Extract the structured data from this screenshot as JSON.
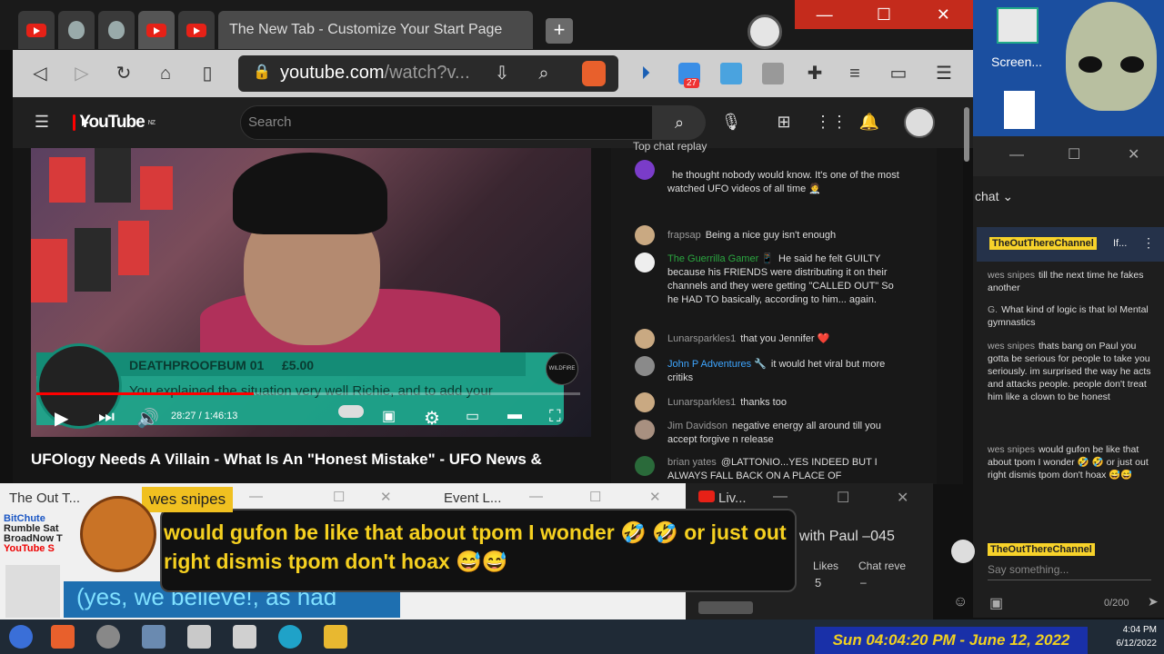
{
  "browser": {
    "active_tab_title": "The New Tab - Customize Your Start Page",
    "new_tab_label": "+",
    "url_main": "youtube.com",
    "url_rest": "/watch?v...",
    "window_controls": [
      "—",
      "☐",
      "✕"
    ],
    "extension_badge": "27"
  },
  "youtube": {
    "logo_text": "YouTube",
    "logo_sup": "NZ",
    "search_placeholder": "Search"
  },
  "video": {
    "superchat_name": "DEATHPROOFBUM 01",
    "superchat_amount": "£5.00",
    "superchat_message": "You explained the situation very well Richie, and to add your",
    "time": "28:27 / 1:46:13",
    "watermark": "WILDFIRE",
    "title": "UFOlogy Needs A Villain - What Is An \"Honest Mistake\" - UFO News &"
  },
  "live_chat": {
    "header": "Top chat replay",
    "messages": [
      {
        "author": "",
        "text": "he thought nobody would know. It's one of the most watched UFO videos of all time 🧑‍⚕️",
        "style": ""
      },
      {
        "author": "frapsap",
        "text": "Being a nice guy isn't enough",
        "style": ""
      },
      {
        "author": "The Guerrilla Gamer 📱",
        "text": "He said he felt GUILTY because his FRIENDS were distributing it on their channels and they were getting \"CALLED OUT\" So he HAD TO basically, according to him... again.",
        "style": "g"
      },
      {
        "author": "Lunarsparkles1",
        "text": "that you Jennifer ❤️",
        "style": ""
      },
      {
        "author": "John P Adventures 🔧",
        "text": "it would het viral but more critiks",
        "style": "b"
      },
      {
        "author": "Lunarsparkles1",
        "text": "thanks too",
        "style": ""
      },
      {
        "author": "Jim Davidson",
        "text": "negative energy all around till you accept forgive n release",
        "style": ""
      },
      {
        "author": "brian yates",
        "text": "@LATTONIO...YES INDEED BUT I ALWAYS FALL BACK ON A PLACE OF",
        "style": ""
      }
    ]
  },
  "popout_chat": {
    "title": "chat ⌄",
    "pinned_badge": "TheOutThereChannel",
    "pinned_text": "If...",
    "messages": [
      {
        "author": "wes snipes",
        "text": "till the next time he fakes another"
      },
      {
        "author": "G.",
        "text": "What kind of logic is that lol Mental gymnastics"
      },
      {
        "author": "wes snipes",
        "text": "thats bang on Paul you gotta be serious for people to take you seriously. im surprised the way he acts and attacks people. people don't treat him like a clown to be honest"
      },
      {
        "author": "wes snipes",
        "text": "would gufon be like that about tpom I wonder 🤣 🤣 or just out right dismis tpom don't hoax 😅😅"
      }
    ],
    "input_badge": "TheOutThereChannel",
    "input_placeholder": "Say something...",
    "char_count": "0/200"
  },
  "overlay": {
    "win1_title": "The Out T...",
    "win2_title": "Event L...",
    "win3_title": "Liv...",
    "big_author": "wes snipes",
    "big_message": "would gufon be like that about tpom I wonder 🤣 🤣 or just out right dismis tpom don't hoax 😅😅",
    "believe_text": "(yes, we believe!, as had",
    "stream_title": "t with Paul –045",
    "likes_label": "Likes",
    "likes_value": "5",
    "chat_rev_label": "Chat reve",
    "chat_rev_value": "–",
    "bitchute_lines": [
      "BitChute",
      "Rumble Sat",
      "BroadNow T",
      "YouTube S"
    ]
  },
  "desktop": {
    "screen_label": "Screen..."
  },
  "taskbar": {
    "date_banner": "Sun 04:04:20 PM - June 12, 2022",
    "clock_time": "4:04 PM",
    "clock_date": "6/12/2022"
  }
}
